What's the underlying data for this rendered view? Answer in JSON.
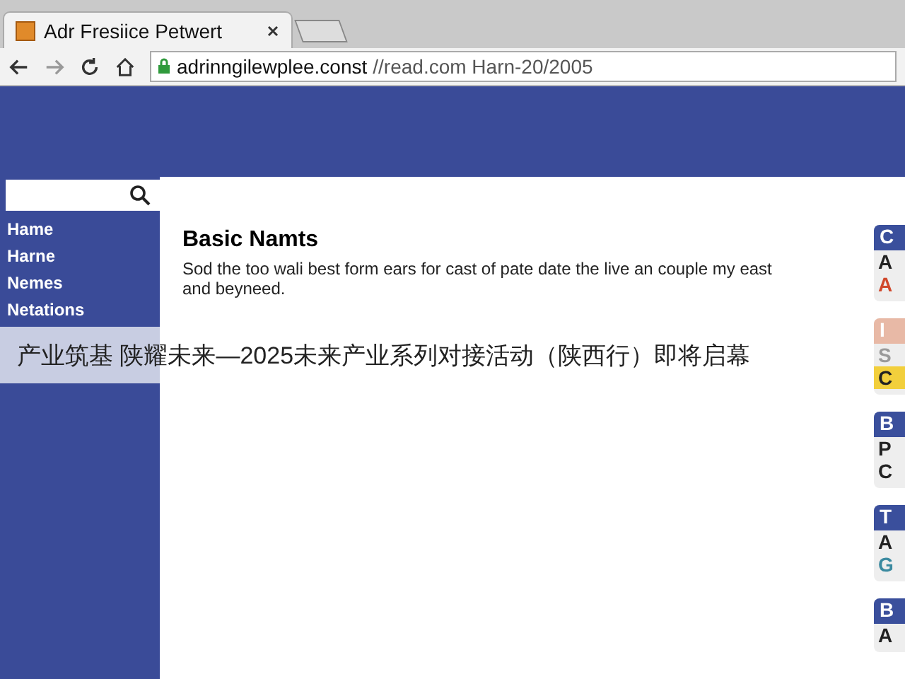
{
  "browser": {
    "tab_title": "Adr Fresiice Petwert",
    "url_host": "adrinngilewplee.const",
    "url_path": "//read.com Harn-20/2005"
  },
  "sidebar": {
    "items": [
      {
        "label": "Hame"
      },
      {
        "label": "Harne"
      },
      {
        "label": "Nemes"
      },
      {
        "label": "Netations"
      }
    ]
  },
  "article": {
    "title": "Basic Namts",
    "body": "Sod the too wali best form ears for cast of pate date the live an couple my east and beyneed."
  },
  "side_cards": [
    {
      "header": "C",
      "color": "#3a4f9c",
      "lines": [
        {
          "text": "A",
          "color": "#222222"
        },
        {
          "text": "A",
          "color": "#d0482c"
        }
      ]
    },
    {
      "header": "I",
      "color": "#e8b9a6",
      "lines": [
        {
          "text": "S",
          "color": "#9a9a9a"
        },
        {
          "text": "C",
          "highlight": true
        }
      ]
    },
    {
      "header": "B",
      "color": "#3a4f9c",
      "lines": [
        {
          "text": "P",
          "color": "#222222"
        },
        {
          "text": "C",
          "color": "#222222"
        }
      ]
    },
    {
      "header": "T",
      "color": "#3a4f9c",
      "lines": [
        {
          "text": "A",
          "color": "#222222"
        },
        {
          "text": "G",
          "color": "#3b8aa0"
        }
      ]
    },
    {
      "header": "B",
      "color": "#3a4f9c",
      "lines": [
        {
          "text": "A",
          "color": "#222222"
        }
      ]
    }
  ],
  "caption": "产业筑基 陕耀未来—2025未来产业系列对接活动（陕西行）即将启幕"
}
